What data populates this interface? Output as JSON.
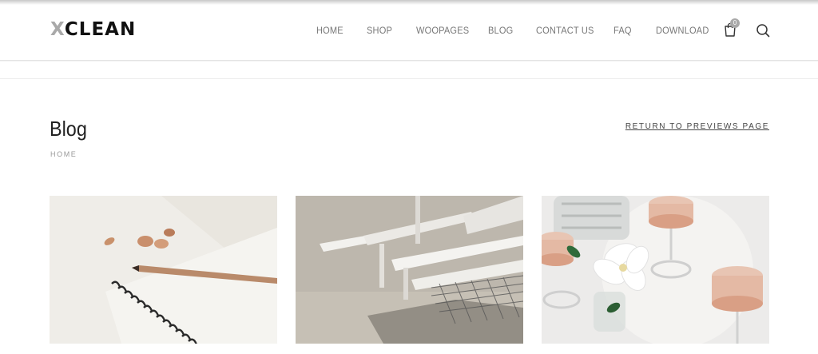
{
  "brand": {
    "logo_x": "X",
    "logo_rest": "CLEAN"
  },
  "nav": {
    "items": [
      {
        "label": "HOME"
      },
      {
        "label": "SHOP"
      },
      {
        "label": "WOOPAGES"
      },
      {
        "label": "BLOG"
      },
      {
        "label": "CONTACT US"
      },
      {
        "label": "FAQ"
      },
      {
        "label": "DOWNLOAD"
      }
    ],
    "cart_count": "0"
  },
  "page": {
    "title": "Blog",
    "breadcrumb": "HOME",
    "return_link": "RETURN TO PREVIEWS PAGE"
  },
  "posts": [
    {
      "image": "notebook-pencil-image"
    },
    {
      "image": "white-bench-image"
    },
    {
      "image": "glasses-flower-image"
    }
  ],
  "colors": {
    "accent_gray": "#a9a9a9",
    "text_dark": "#222222",
    "nav_text": "#777777"
  }
}
